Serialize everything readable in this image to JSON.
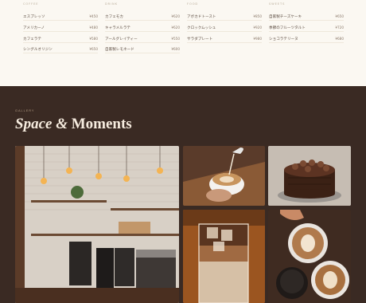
{
  "menu": {
    "columns": [
      {
        "heading": "COFFEE",
        "items": [
          {
            "name": "エスプレッソ",
            "price": "¥450"
          },
          {
            "name": "アメリカーノ",
            "price": "¥480"
          },
          {
            "name": "カフェラテ",
            "price": "¥580"
          },
          {
            "name": "シングルオリジン",
            "price": "¥650"
          }
        ]
      },
      {
        "heading": "DRINK",
        "items": [
          {
            "name": "カフェモカ",
            "price": "¥620"
          },
          {
            "name": "キャラメルラテ",
            "price": "¥620"
          },
          {
            "name": "アールグレイティー",
            "price": "¥550"
          },
          {
            "name": "自家製レモネード",
            "price": "¥600"
          }
        ]
      },
      {
        "heading": "FOOD",
        "items": [
          {
            "name": "アボカドトースト",
            "price": "¥850"
          },
          {
            "name": "クロックムッシュ",
            "price": "¥920"
          },
          {
            "name": "サラダプレート",
            "price": "¥980"
          }
        ]
      },
      {
        "heading": "SWEETS",
        "items": [
          {
            "name": "自家製チーズケーキ",
            "price": "¥650"
          },
          {
            "name": "季節のフルーツタルト",
            "price": "¥720"
          },
          {
            "name": "ショコラテリーヌ",
            "price": "¥680"
          }
        ]
      }
    ]
  },
  "gallery": {
    "eyebrow": "GALLERY",
    "title_part1": "Space",
    "title_amp": "&",
    "title_part2": "Moments",
    "photos": [
      {
        "icon": "cafe-interior-photo"
      },
      {
        "icon": "latte-pour-photo"
      },
      {
        "icon": "chocolate-cake-photo"
      },
      {
        "icon": "iced-latte-photo"
      },
      {
        "icon": "latte-art-cups-photo"
      }
    ]
  },
  "colors": {
    "menu_bg": "#fbf8f2",
    "gallery_bg": "#3a2a23",
    "title": "#f6ecdf",
    "accent": "#b49d85"
  }
}
